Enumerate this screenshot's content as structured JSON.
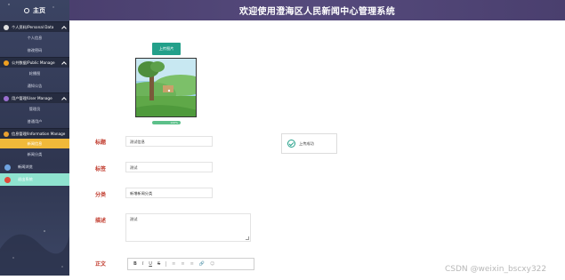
{
  "header": {
    "title": "欢迎使用澄海区人民新闻中心管理系统"
  },
  "sidebar": {
    "home_label": "主页",
    "sections": [
      {
        "label": "个人资料/Personal Data",
        "icon": "person-icon",
        "icon_color": "#e0e0e0",
        "items": [
          "个人信息",
          "修改密码"
        ]
      },
      {
        "label": "公共数据/Public Manage",
        "icon": "globe-icon",
        "icon_color": "#f0a020",
        "items": [
          "轮播图",
          "通知公告"
        ]
      },
      {
        "label": "用户管理/User Manage",
        "icon": "user-icon",
        "icon_color": "#9b6fd0",
        "items": [
          "管理员",
          "普通用户"
        ]
      },
      {
        "label": "信息管理/Information Manage",
        "icon": "info-icon",
        "icon_color": "#e8a030",
        "items": [
          "新闻信息",
          "新闻分类"
        ]
      }
    ],
    "extra_items": [
      {
        "label": "新闻浏览",
        "icon": "browse-icon",
        "icon_color": "#6fa3e0"
      },
      {
        "label": "退出系统",
        "icon": "logout-icon",
        "icon_color": "#e04a3a"
      }
    ]
  },
  "form": {
    "upload_label": "上传图片",
    "progress_text": "100%",
    "progress_value": 1.0,
    "title_label": "标题",
    "title_value": "测试信息",
    "tag_label": "标签",
    "tag_value": "测试",
    "category_label": "分类",
    "category_value": "新增新闻分类",
    "desc_label": "描述",
    "desc_value": "测试",
    "body_label": "正文"
  },
  "toast": {
    "text": "上传成功"
  },
  "editor": {
    "tools": [
      "B",
      "I",
      "U",
      "S",
      "≡",
      "≡",
      "≡",
      "🔗",
      "☺"
    ]
  },
  "watermark": "CSDN @weixin_bscxy322",
  "colors": {
    "accent": "#23a08a",
    "label_red": "#c0392b",
    "active_menu": "#f0b93a",
    "header_bg": "#4a3f6e"
  }
}
